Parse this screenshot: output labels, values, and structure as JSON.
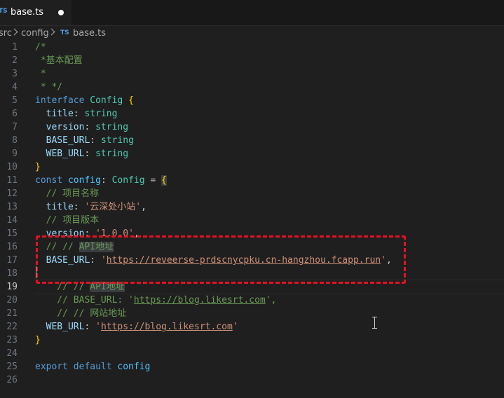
{
  "tab": {
    "icon": "TS",
    "name": "base.ts"
  },
  "breadcrumb": {
    "items": [
      "src",
      "config",
      "base.ts"
    ],
    "file_icon": "TS"
  },
  "lines": [
    {
      "n": "1",
      "tokens": [
        {
          "c": "c",
          "t": "/*"
        }
      ]
    },
    {
      "n": "2",
      "tokens": [
        {
          "c": "c",
          "t": " *基本配置"
        }
      ]
    },
    {
      "n": "3",
      "tokens": [
        {
          "c": "c",
          "t": " *"
        }
      ]
    },
    {
      "n": "4",
      "tokens": [
        {
          "c": "c",
          "t": " * */"
        }
      ]
    },
    {
      "n": "5",
      "tokens": [
        {
          "c": "k",
          "t": "interface "
        },
        {
          "c": "t",
          "t": "Config "
        },
        {
          "c": "b",
          "t": "{"
        }
      ]
    },
    {
      "n": "6",
      "tokens": [
        {
          "c": "p",
          "t": "  title"
        },
        {
          "c": "w",
          "t": ": "
        },
        {
          "c": "t",
          "t": "string"
        }
      ]
    },
    {
      "n": "7",
      "tokens": [
        {
          "c": "p",
          "t": "  version"
        },
        {
          "c": "w",
          "t": ": "
        },
        {
          "c": "t",
          "t": "string"
        }
      ]
    },
    {
      "n": "8",
      "tokens": [
        {
          "c": "p",
          "t": "  BASE_URL"
        },
        {
          "c": "w",
          "t": ": "
        },
        {
          "c": "t",
          "t": "string"
        }
      ]
    },
    {
      "n": "9",
      "tokens": [
        {
          "c": "p",
          "t": "  WEB_URL"
        },
        {
          "c": "w",
          "t": ": "
        },
        {
          "c": "t",
          "t": "string"
        }
      ]
    },
    {
      "n": "10",
      "tokens": [
        {
          "c": "b",
          "t": "}"
        }
      ]
    },
    {
      "n": "11",
      "tokens": [
        {
          "c": "k",
          "t": "const "
        },
        {
          "c": "v",
          "t": "config"
        },
        {
          "c": "w",
          "t": ": "
        },
        {
          "c": "t",
          "t": "Config"
        },
        {
          "c": "w",
          "t": " = "
        },
        {
          "c": "b hl",
          "t": "{"
        }
      ]
    },
    {
      "n": "12",
      "tokens": [
        {
          "c": "c",
          "t": "  // 项目名称"
        }
      ]
    },
    {
      "n": "13",
      "tokens": [
        {
          "c": "p",
          "t": "  title"
        },
        {
          "c": "w",
          "t": ": "
        },
        {
          "c": "s",
          "t": "'云深处小站'"
        },
        {
          "c": "w",
          "t": ","
        }
      ]
    },
    {
      "n": "14",
      "tokens": [
        {
          "c": "c",
          "t": "  // 项目版本"
        }
      ]
    },
    {
      "n": "15",
      "tokens": [
        {
          "c": "p",
          "t": "  version"
        },
        {
          "c": "w",
          "t": ": "
        },
        {
          "c": "s",
          "t": "'1.0.0'"
        },
        {
          "c": "w",
          "t": ","
        }
      ]
    },
    {
      "n": "16",
      "tokens": [
        {
          "c": "c",
          "t": "  // // "
        },
        {
          "c": "c hl",
          "t": "API地址"
        }
      ]
    },
    {
      "n": "17",
      "tokens": [
        {
          "c": "p",
          "t": "  BASE_URL"
        },
        {
          "c": "w",
          "t": ": "
        },
        {
          "c": "s",
          "t": "'"
        },
        {
          "c": "s u",
          "t": "https://reveerse-prdscnycpku.cn-hangzhou.fcapp.run"
        },
        {
          "c": "s",
          "t": "'"
        },
        {
          "c": "w",
          "t": ","
        }
      ]
    },
    {
      "n": "18",
      "tokens": []
    },
    {
      "n": "19",
      "tokens": [
        {
          "c": "c",
          "t": "    // // "
        },
        {
          "c": "c hl",
          "t": "API地址"
        }
      ],
      "active": true
    },
    {
      "n": "20",
      "tokens": [
        {
          "c": "c",
          "t": "    // BASE_URL: '"
        },
        {
          "c": "c u",
          "t": "https://blog.likesrt.com"
        },
        {
          "c": "c",
          "t": "',"
        }
      ]
    },
    {
      "n": "21",
      "tokens": [
        {
          "c": "c",
          "t": "    // // 网站地址"
        }
      ]
    },
    {
      "n": "22",
      "tokens": [
        {
          "c": "p",
          "t": "  WEB_URL"
        },
        {
          "c": "w",
          "t": ": "
        },
        {
          "c": "s",
          "t": "'"
        },
        {
          "c": "s u",
          "t": "https://blog.likesrt.com"
        },
        {
          "c": "s",
          "t": "'"
        }
      ]
    },
    {
      "n": "23",
      "tokens": [
        {
          "c": "b",
          "t": "}"
        }
      ]
    },
    {
      "n": "24",
      "tokens": []
    },
    {
      "n": "25",
      "tokens": [
        {
          "c": "k",
          "t": "export default "
        },
        {
          "c": "v",
          "t": "config"
        }
      ]
    },
    {
      "n": "26",
      "tokens": []
    }
  ]
}
